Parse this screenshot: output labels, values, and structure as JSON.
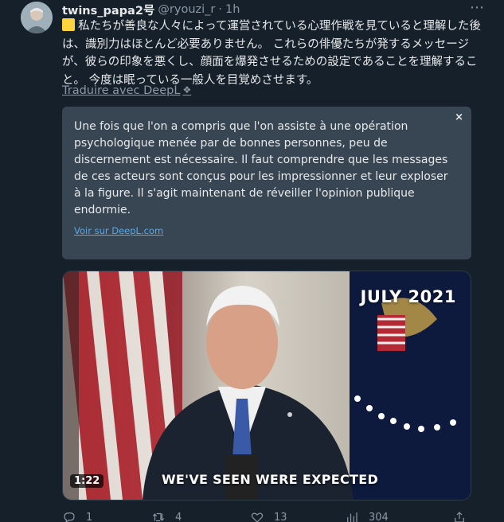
{
  "tweet": {
    "author_name": "twins_papa2号",
    "handle": "@ryouzi_r",
    "separator": "·",
    "time": "1h",
    "more_label": "⋯",
    "text": "私たちが善良な人々によって運営されている心理作戦を見ていると理解した後は、識別力はほとんど必要ありません。 これらの俳優たちが発するメッセージが、彼らの印象を悪くし、顔面を爆発させるための設定であることを理解すること。 今度は眠っている一般人を目覚めさせます。",
    "translate_link": "Traduire avec DeepL",
    "deepl_icon": "❖"
  },
  "translation_card": {
    "close_label": "×",
    "text": "Une fois que l'on a compris que l'on assiste à une opération psychologique menée par de bonnes personnes, peu de discernement est nécessaire. Il faut comprendre que les messages de ces acteurs sont conçus pour les impressionner et leur exploser à la figure. Il s'agit maintenant de réveiller l'opinion publique endormie.",
    "view_link": "Voir sur DeepL.com"
  },
  "video": {
    "date_overlay": "JULY 2021",
    "caption": "WE'VE SEEN WERE EXPECTED",
    "duration": "1:22"
  },
  "actions": {
    "replies": "1",
    "retweets": "4",
    "likes": "13",
    "views": "304"
  },
  "colors": {
    "background": "#15202b",
    "card": "#384552",
    "link": "#5aa9e6",
    "muted": "#8b98a5"
  }
}
